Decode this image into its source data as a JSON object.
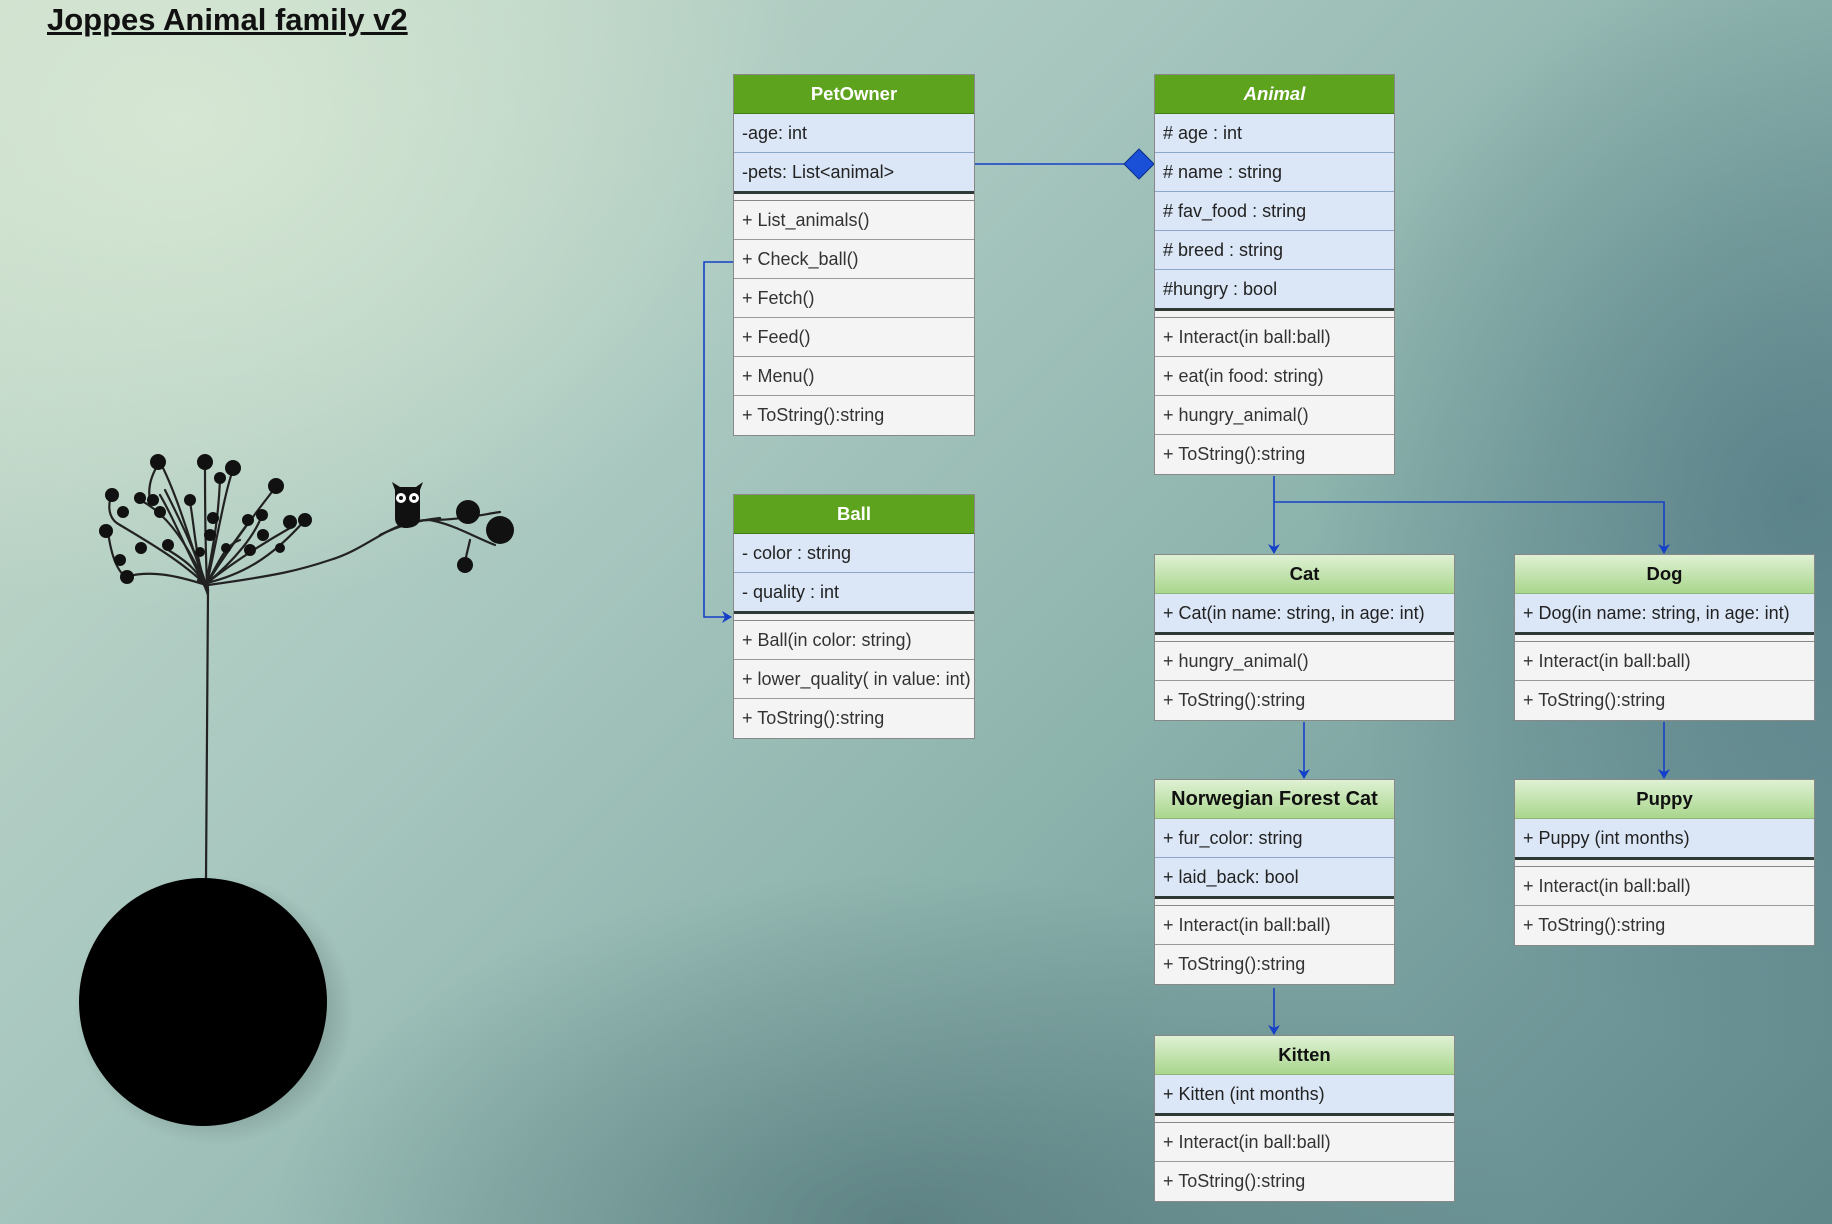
{
  "title": "Joppes Animal family v2",
  "colors": {
    "header_dark": "#5ea31e",
    "header_light": "#a9d68c",
    "attribute_bg": "#dbe7f7",
    "method_bg": "#f4f4f4",
    "connector": "#1540c8",
    "aggregation_diamond": "#1a4fd8"
  },
  "classes": {
    "petowner": {
      "name": "PetOwner",
      "attributes": [
        "-age: int",
        "-pets: List<animal>"
      ],
      "methods": [
        "+ List_animals()",
        "+ Check_ball()",
        "+ Fetch()",
        "+ Feed()",
        "+ Menu()",
        "+ ToString():string"
      ]
    },
    "ball": {
      "name": "Ball",
      "attributes": [
        "- color : string",
        "- quality : int"
      ],
      "methods": [
        "+ Ball(in color: string)",
        "+ lower_quality( in value: int)",
        "+ ToString():string"
      ]
    },
    "animal": {
      "name": "Animal",
      "attributes": [
        "# age : int",
        "# name : string",
        "# fav_food : string",
        "# breed : string",
        "#hungry : bool"
      ],
      "methods": [
        "+ Interact(in ball:ball)",
        "+ eat(in food: string)",
        "+ hungry_animal()",
        "+ ToString():string"
      ]
    },
    "cat": {
      "name": "Cat",
      "attributes": [
        "+ Cat(in name: string, in age: int)"
      ],
      "methods": [
        "+ hungry_animal()",
        "+ ToString():string"
      ]
    },
    "dog": {
      "name": "Dog",
      "attributes": [
        "+ Dog(in name: string, in age: int)"
      ],
      "methods": [
        "+ Interact(in ball:ball)",
        "+ ToString():string"
      ]
    },
    "nfc": {
      "name": "Norwegian Forest Cat",
      "attributes": [
        "+ fur_color: string",
        "+ laid_back: bool"
      ],
      "methods": [
        "+ Interact(in ball:ball)",
        "+ ToString():string"
      ]
    },
    "puppy": {
      "name": "Puppy",
      "attributes": [
        "+ Puppy (int months)"
      ],
      "methods": [
        "+ Interact(in ball:ball)",
        "+ ToString():string"
      ]
    },
    "kitten": {
      "name": "Kitten",
      "attributes": [
        "+ Kitten (int months)"
      ],
      "methods": [
        "+ Interact(in ball:ball)",
        "+ ToString():string"
      ]
    }
  }
}
